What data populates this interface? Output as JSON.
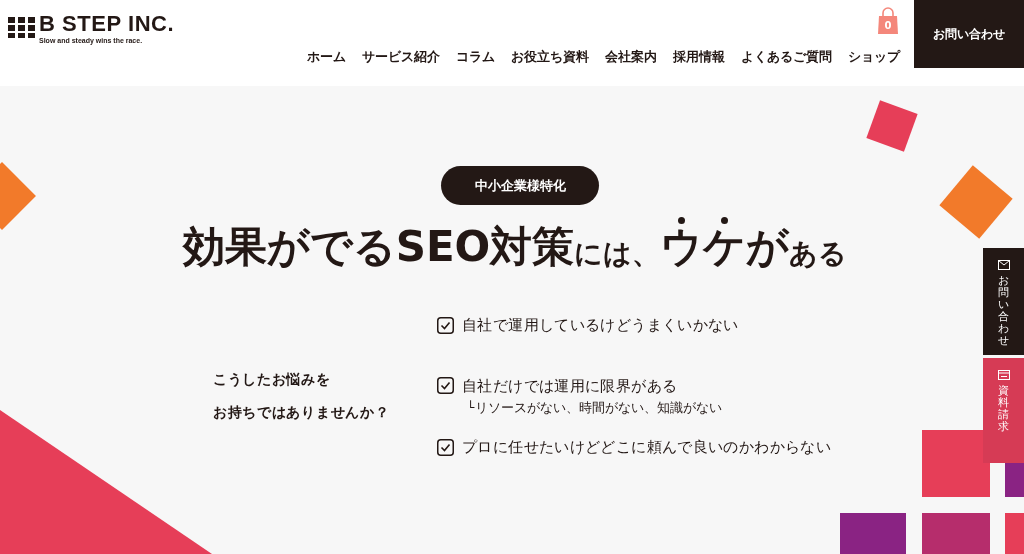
{
  "header": {
    "logo": {
      "name": "B STEP INC.",
      "tagline": "Slow and steady wins the race."
    },
    "nav": [
      {
        "label": "ホーム"
      },
      {
        "label": "サービス紹介"
      },
      {
        "label": "コラム"
      },
      {
        "label": "お役立ち資料"
      },
      {
        "label": "会社案内"
      },
      {
        "label": "採用情報"
      },
      {
        "label": "よくあるご質問"
      },
      {
        "label": "ショップ"
      }
    ],
    "cart": {
      "count": "0"
    },
    "contact_button": "お問い合わせ"
  },
  "hero": {
    "badge": "中小企業様特化",
    "headline": [
      {
        "text": "効果がでるSEO対策",
        "kind": "large"
      },
      {
        "text": "には、",
        "kind": "small"
      },
      {
        "text": "ウケ",
        "kind": "dotted"
      },
      {
        "text": "が",
        "kind": "large"
      },
      {
        "text": "ある",
        "kind": "small"
      }
    ],
    "question": [
      "こうしたお悩みを",
      "お持ちではありませんか？"
    ],
    "checklist": [
      {
        "text": "自社で運用しているけどうまくいかない",
        "checked": true
      },
      {
        "text": "自社だけでは運用に限界がある",
        "checked": true,
        "note": "└リソースがない、時間がない、知識がない"
      },
      {
        "text": "プロに任せたいけどどこに頼んで良いのかわからない",
        "checked": true
      }
    ]
  },
  "side_tabs": [
    {
      "kind": "mail",
      "label": "お問い合わせ"
    },
    {
      "kind": "document",
      "label": "資料請求"
    }
  ]
}
